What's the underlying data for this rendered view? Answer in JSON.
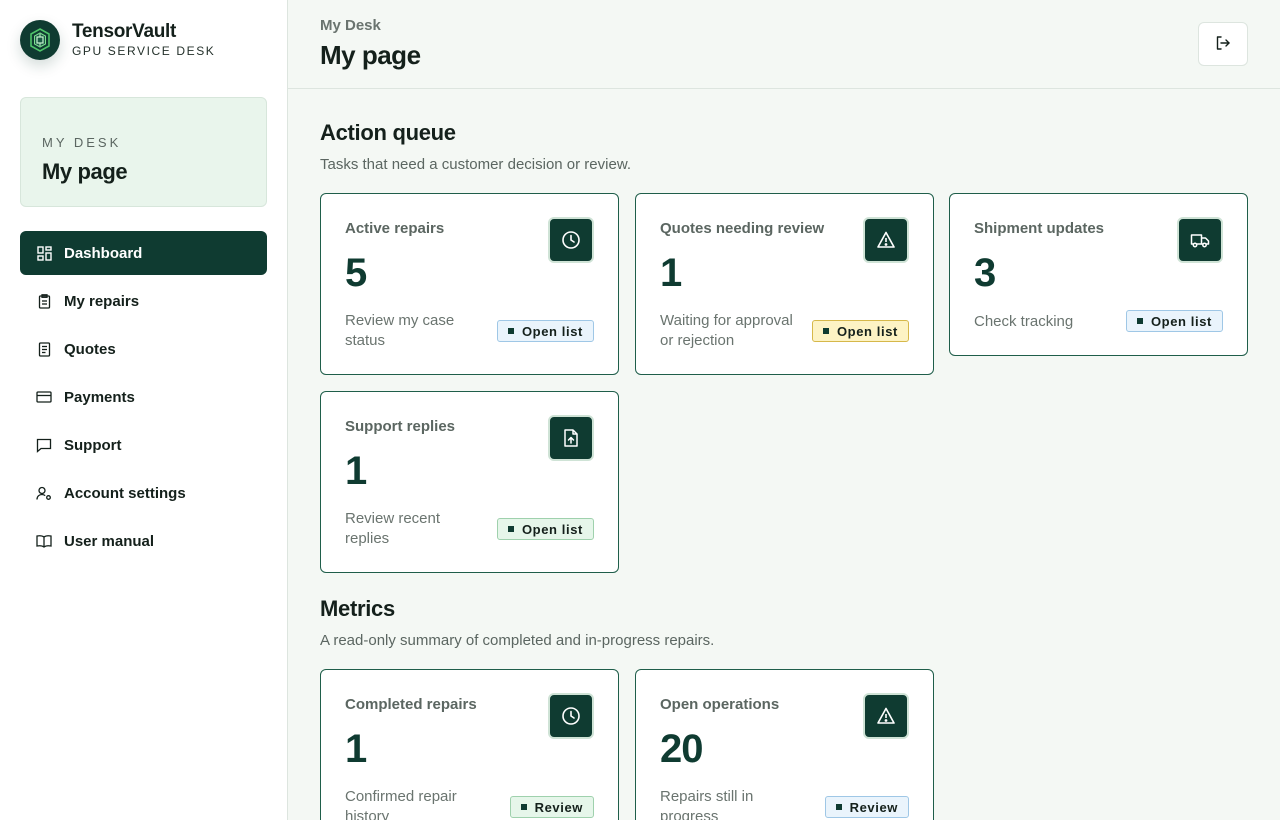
{
  "brand": {
    "name": "TensorVault",
    "subtitle": "GPU SERVICE DESK"
  },
  "desk_card": {
    "kicker": "MY DESK",
    "title": "My page"
  },
  "nav": [
    {
      "label": "Dashboard",
      "icon": "dashboard-icon",
      "active": true
    },
    {
      "label": "My repairs",
      "icon": "clipboard-icon"
    },
    {
      "label": "Quotes",
      "icon": "document-icon"
    },
    {
      "label": "Payments",
      "icon": "credit-card-icon"
    },
    {
      "label": "Support",
      "icon": "chat-icon"
    },
    {
      "label": "Account settings",
      "icon": "user-gear-icon"
    },
    {
      "label": "User manual",
      "icon": "book-icon"
    }
  ],
  "header": {
    "kicker": "My Desk",
    "title": "My page",
    "logout_icon": "logout-icon"
  },
  "action_queue": {
    "title": "Action queue",
    "subtitle": "Tasks that need a customer decision or review.",
    "cards": [
      {
        "label": "Active repairs",
        "value": "5",
        "desc": "Review my case status",
        "badge": "Open list",
        "badge_style": "blue",
        "icon": "clock-icon"
      },
      {
        "label": "Quotes needing review",
        "value": "1",
        "desc": "Waiting for approval or rejection",
        "badge": "Open list",
        "badge_style": "yellow",
        "icon": "warning-icon"
      },
      {
        "label": "Shipment updates",
        "value": "3",
        "desc": "Check tracking",
        "badge": "Open list",
        "badge_style": "blue",
        "icon": "truck-icon"
      },
      {
        "label": "Support replies",
        "value": "1",
        "desc": "Review recent replies",
        "badge": "Open list",
        "badge_style": "green",
        "icon": "upload-file-icon"
      }
    ]
  },
  "metrics": {
    "title": "Metrics",
    "subtitle": "A read-only summary of completed and in-progress repairs.",
    "cards": [
      {
        "label": "Completed repairs",
        "value": "1",
        "desc": "Confirmed repair history",
        "badge": "Review",
        "badge_style": "green",
        "icon": "clock-icon"
      },
      {
        "label": "Open operations",
        "value": "20",
        "desc": "Repairs still in progress",
        "badge": "Review",
        "badge_style": "blue",
        "icon": "warning-icon"
      }
    ]
  },
  "colors": {
    "primary": "#0f3b31",
    "background": "#f4f8f4",
    "card_border": "#1f5e4a"
  }
}
